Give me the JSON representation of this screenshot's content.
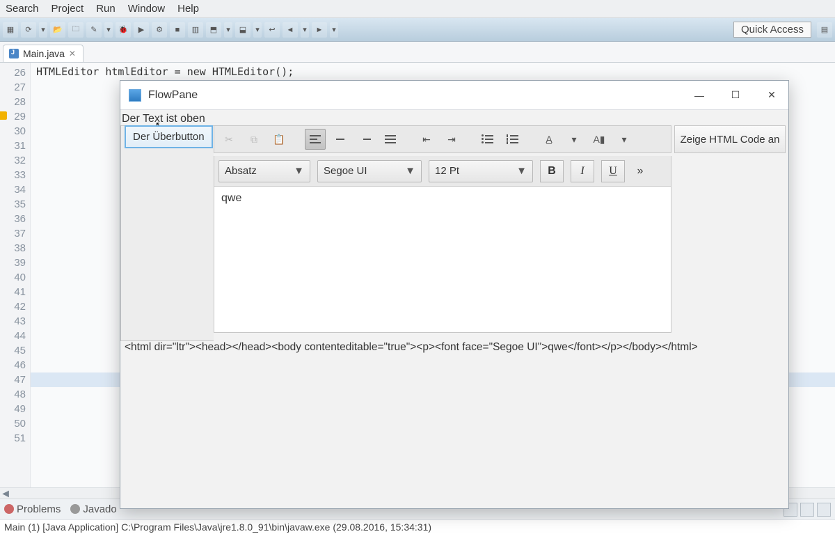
{
  "menubar": {
    "items": [
      "Search",
      "Project",
      "Run",
      "Window",
      "Help"
    ]
  },
  "quickAccess": "Quick Access",
  "tab": {
    "filename": "Main.java"
  },
  "gutter": {
    "start": 26,
    "end": 51,
    "warnLine": 29,
    "highlightLine": 47
  },
  "codeSnippet": "HTMLEditor htmlEditor = new HTMLEditor();",
  "bottomTabs": {
    "problems": "Problems",
    "javadoc": "Javado"
  },
  "consoleLine": "Main (1) [Java Application] C:\\Program Files\\Java\\jre1.8.0_91\\bin\\javaw.exe (29.08.2016, 15:34:31)",
  "dialog": {
    "title": "FlowPane",
    "topLabel": "Der Text ist oben",
    "buttonLabel": "Der Überbutton",
    "showHtmlLabel": "Zeige HTML Code an",
    "paragraphCombo": "Absatz",
    "fontCombo": "Segoe UI",
    "sizeCombo": "12 Pt",
    "bold": "B",
    "italic": "I",
    "underline": "U",
    "overflow": "»",
    "editorContent": "qwe",
    "htmlOutput": "<html dir=\"ltr\"><head></head><body contenteditable=\"true\"><p><font face=\"Segoe UI\">qwe</font></p></body></html>"
  }
}
